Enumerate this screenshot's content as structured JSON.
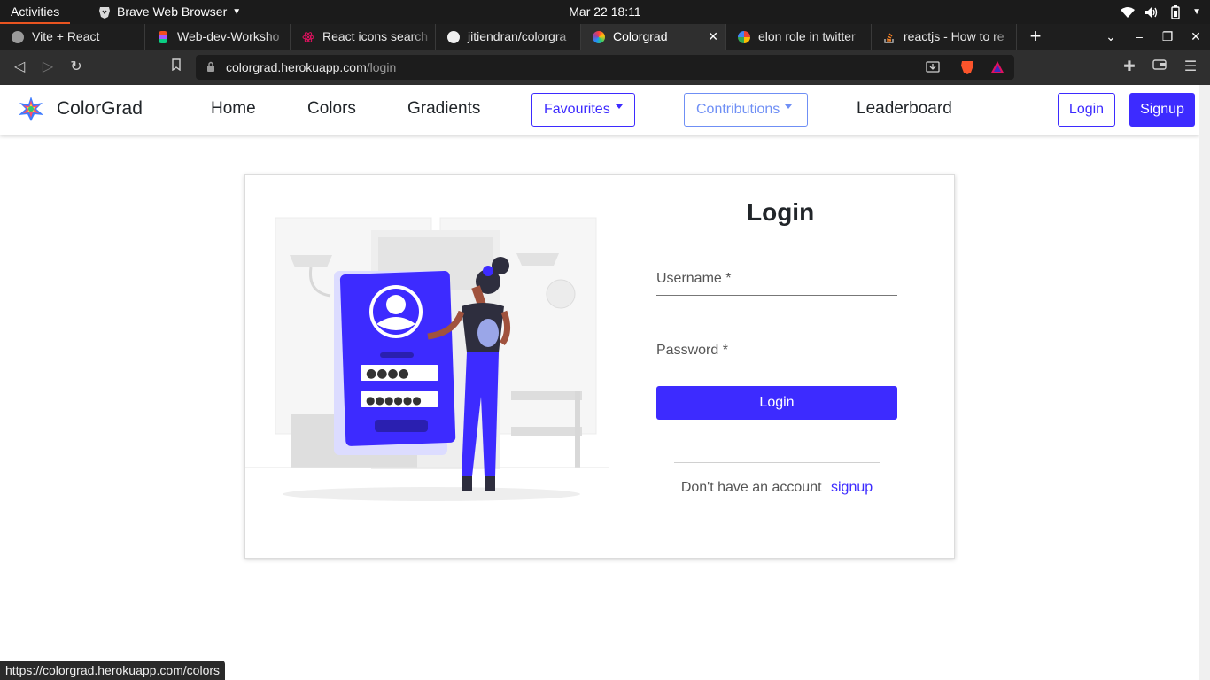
{
  "system": {
    "activities": "Activities",
    "app_name": "Brave Web Browser",
    "datetime": "Mar 22  18:11"
  },
  "tabs": [
    {
      "title": "Vite + React",
      "active": false
    },
    {
      "title": "Web-dev-Worksho",
      "active": false
    },
    {
      "title": "React icons search",
      "active": false
    },
    {
      "title": "jitiendran/colorgra",
      "active": false
    },
    {
      "title": "Colorgrad",
      "active": true
    },
    {
      "title": "elon role in twitter",
      "active": false
    },
    {
      "title": "reactjs - How to re",
      "active": false
    }
  ],
  "address": {
    "host": "colorgrad.herokuapp.com",
    "path": "/login"
  },
  "site": {
    "brand": "ColorGrad",
    "nav": {
      "home": "Home",
      "colors": "Colors",
      "gradients": "Gradients",
      "favourites": "Favourites",
      "contributions": "Contributions",
      "leaderboard": "Leaderboard"
    },
    "login_button": "Login",
    "signup_button": "Signup",
    "accent_color": "#3d2bff"
  },
  "login_form": {
    "title": "Login",
    "username_label": "Username *",
    "password_label": "Password *",
    "submit_label": "Login",
    "no_account_text": "Don't have an account",
    "signup_link": "signup"
  },
  "status_bar": {
    "hover_url": "https://colorgrad.herokuapp.com/colors"
  }
}
